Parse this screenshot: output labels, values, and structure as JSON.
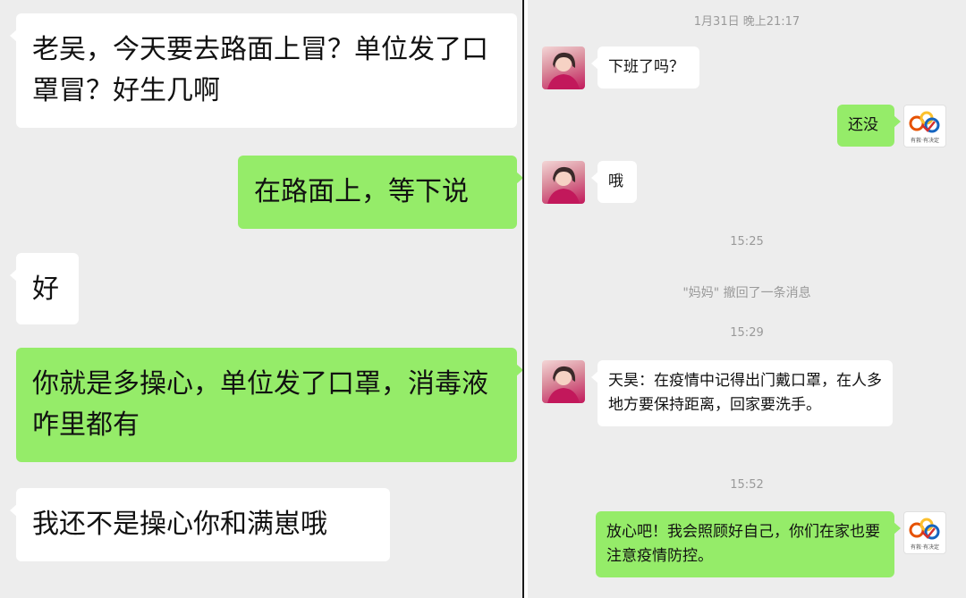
{
  "left_chat": {
    "messages": [
      {
        "side": "in",
        "text": "老吴，今天要去路面上冒？单位发了口罩冒？好生几啊"
      },
      {
        "side": "out",
        "text": "在路面上，等下说"
      },
      {
        "side": "in",
        "text": "好"
      },
      {
        "side": "out",
        "text": "你就是多操心，单位发了口罩，消毒液咋里都有"
      },
      {
        "side": "in",
        "text": "我还不是操心你和满崽哦"
      }
    ]
  },
  "right_chat": {
    "timestamp_1": "1月31日 晚上21:17",
    "msg_1": "下班了吗？",
    "msg_2": "还没",
    "msg_3": "哦",
    "timestamp_2": "15:25",
    "recall_notice": "\"妈妈\" 撤回了一条消息",
    "timestamp_3": "15:29",
    "msg_4": "天昊：在疫情中记得出门戴口罩，在人多地方要保持距离，回家要洗手。",
    "timestamp_4": "15:52",
    "msg_5": "放心吧！我会照顾好自己，你们在家也要注意疫情防控。",
    "my_avatar_caption": "有救·有决定"
  },
  "colors": {
    "chat_background": "#ededed",
    "incoming_bubble": "#ffffff",
    "outgoing_bubble": "#95ec69",
    "timestamp_text": "#9a9a9a"
  },
  "icons": [
    "mom-avatar-icon",
    "user-avatar-logo-icon"
  ]
}
